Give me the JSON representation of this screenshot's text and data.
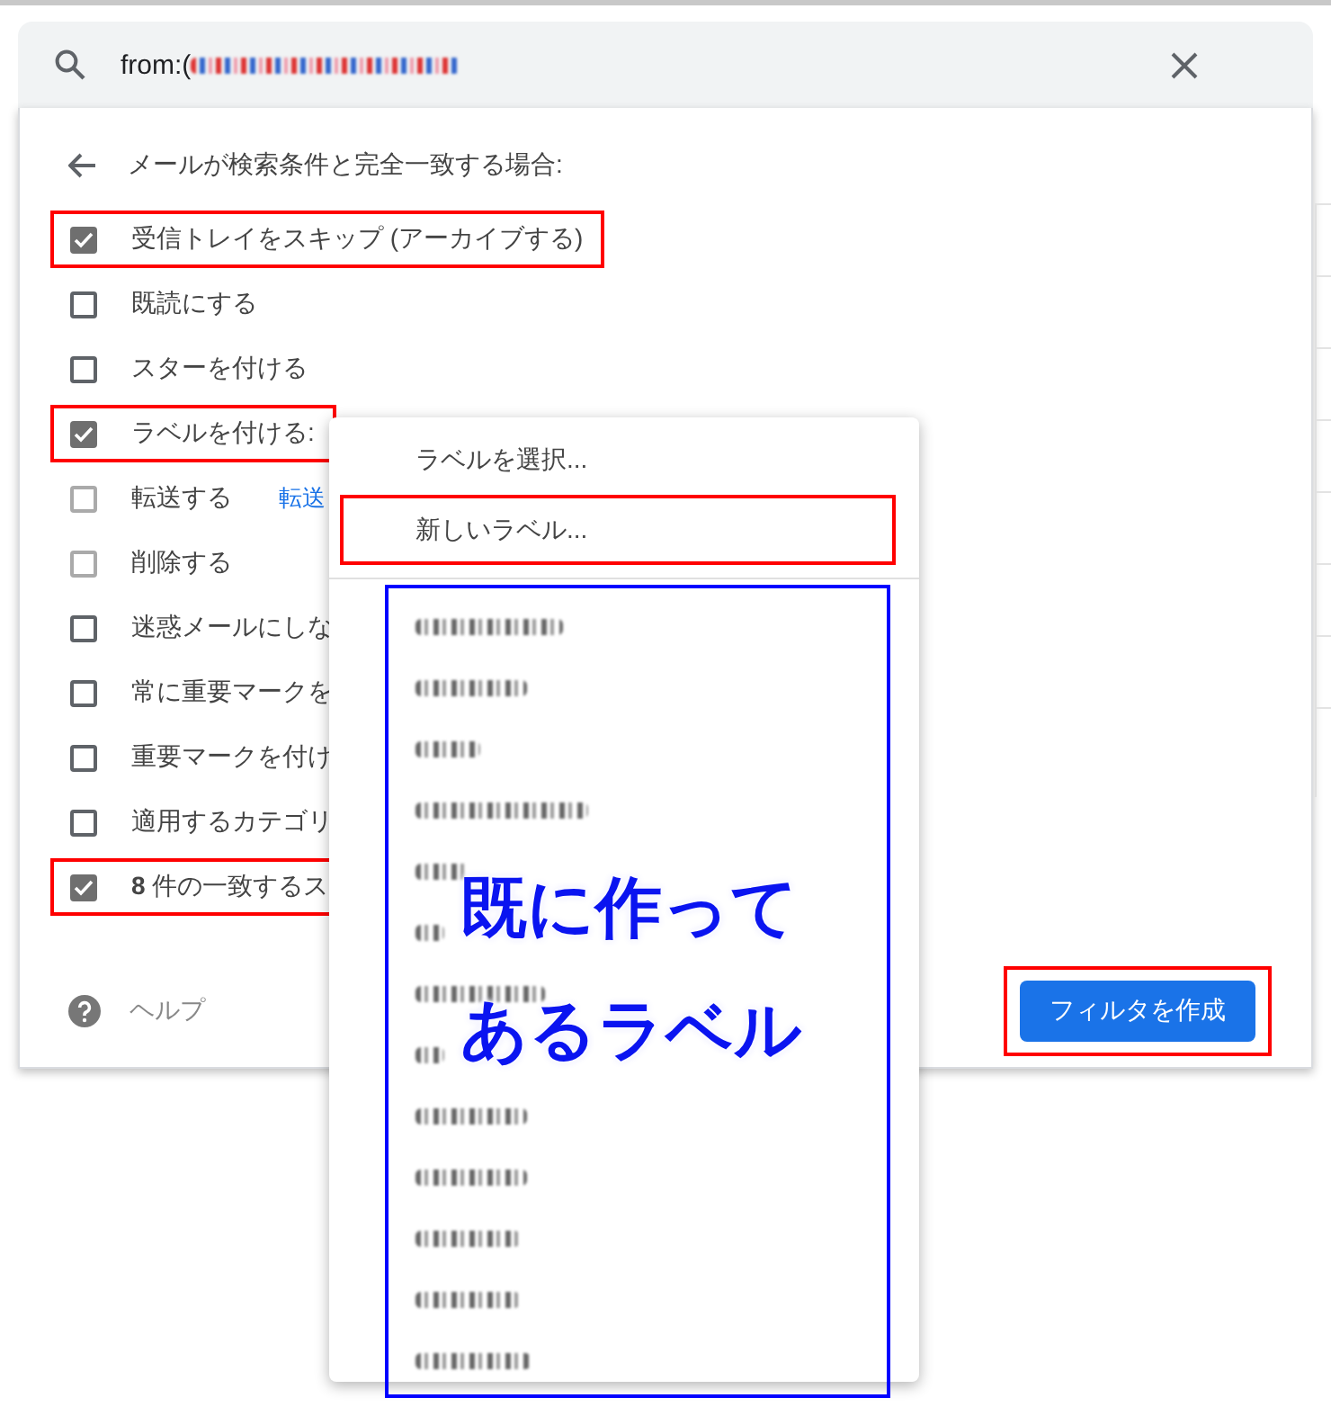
{
  "search": {
    "query": "from:(",
    "query_blurred": true
  },
  "filter_panel": {
    "heading": "メールが検索条件と完全一致する場合:",
    "options": [
      {
        "label": "受信トレイをスキップ (アーカイブする)",
        "checked": true,
        "disabled": false,
        "highlighted": true
      },
      {
        "label": "既読にする",
        "checked": false,
        "disabled": false,
        "highlighted": false
      },
      {
        "label": "スターを付ける",
        "checked": false,
        "disabled": false,
        "highlighted": false
      },
      {
        "label": "ラベルを付ける:",
        "checked": true,
        "disabled": false,
        "highlighted": true
      },
      {
        "label": "転送する",
        "checked": false,
        "disabled": true,
        "highlighted": false,
        "link": "転送"
      },
      {
        "label": "削除する",
        "checked": false,
        "disabled": true,
        "highlighted": false
      },
      {
        "label": "迷惑メールにしな",
        "checked": false,
        "disabled": false,
        "highlighted": false
      },
      {
        "label": "常に重要マークを",
        "checked": false,
        "disabled": false,
        "highlighted": false
      },
      {
        "label": "重要マークを付け",
        "checked": false,
        "disabled": false,
        "highlighted": false
      },
      {
        "label": "適用するカテゴリ",
        "checked": false,
        "disabled": false,
        "highlighted": false
      },
      {
        "label": "**8** 件の一致するス",
        "checked": true,
        "disabled": false,
        "highlighted": true
      }
    ],
    "help": "ヘルプ",
    "create_button": {
      "label": "フィルタを作成",
      "highlighted": true
    }
  },
  "label_menu": {
    "items": [
      {
        "label": "ラベルを選択...",
        "highlighted": false
      },
      {
        "label": "新しいラベル...",
        "highlighted": true
      }
    ],
    "existing_labels_highlighted": true,
    "existing_labels": [
      {
        "kind": "blurred"
      },
      {
        "kind": "blurred"
      },
      {
        "kind": "blurred"
      },
      {
        "kind": "blurred"
      },
      {
        "kind": "blurred"
      },
      {
        "kind": "blurred"
      },
      {
        "kind": "blurred"
      },
      {
        "kind": "blurred"
      },
      {
        "kind": "blurred"
      },
      {
        "kind": "blurred"
      },
      {
        "kind": "blurred"
      },
      {
        "kind": "blurred"
      },
      {
        "kind": "blurred"
      }
    ]
  },
  "annotation": {
    "lines": [
      "既に作って",
      "あるラベル"
    ]
  }
}
